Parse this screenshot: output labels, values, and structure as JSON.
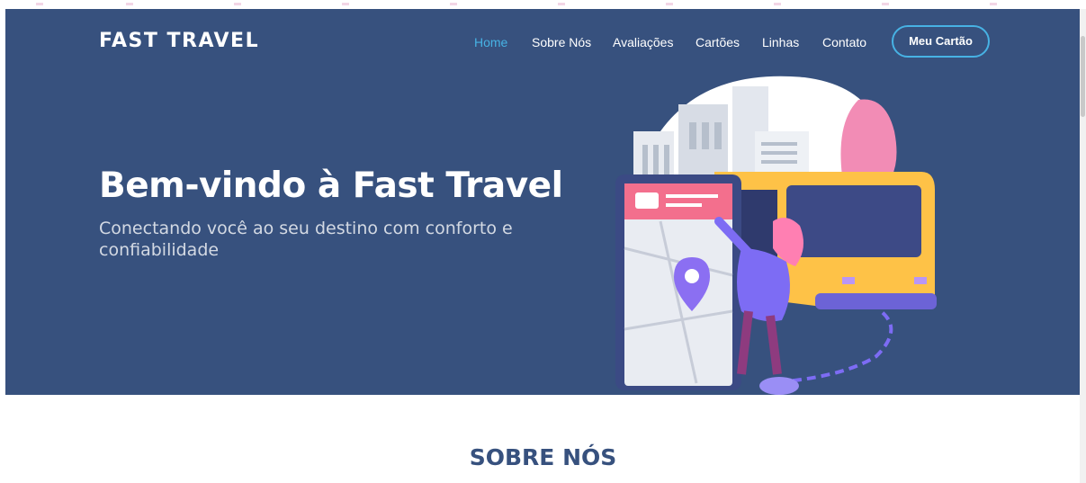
{
  "header": {
    "brand": "FAST TRAVEL",
    "nav": [
      {
        "label": "Home",
        "active": true
      },
      {
        "label": "Sobre Nós",
        "active": false
      },
      {
        "label": "Avaliações",
        "active": false
      },
      {
        "label": "Cartões",
        "active": false
      },
      {
        "label": "Linhas",
        "active": false
      },
      {
        "label": "Contato",
        "active": false
      }
    ],
    "cta_label": "Meu Cartão"
  },
  "hero": {
    "title": "Bem-vindo à Fast Travel",
    "subtitle": "Conectando você ao seu destino com conforto e confiabilidade",
    "illustration": "phone-map-woman-bus-illustration"
  },
  "about": {
    "title": "SOBRE NÓS"
  },
  "colors": {
    "hero_bg": "#37517e",
    "accent": "#47b2e4",
    "text_white": "#ffffff",
    "title_dark": "#37517e"
  }
}
